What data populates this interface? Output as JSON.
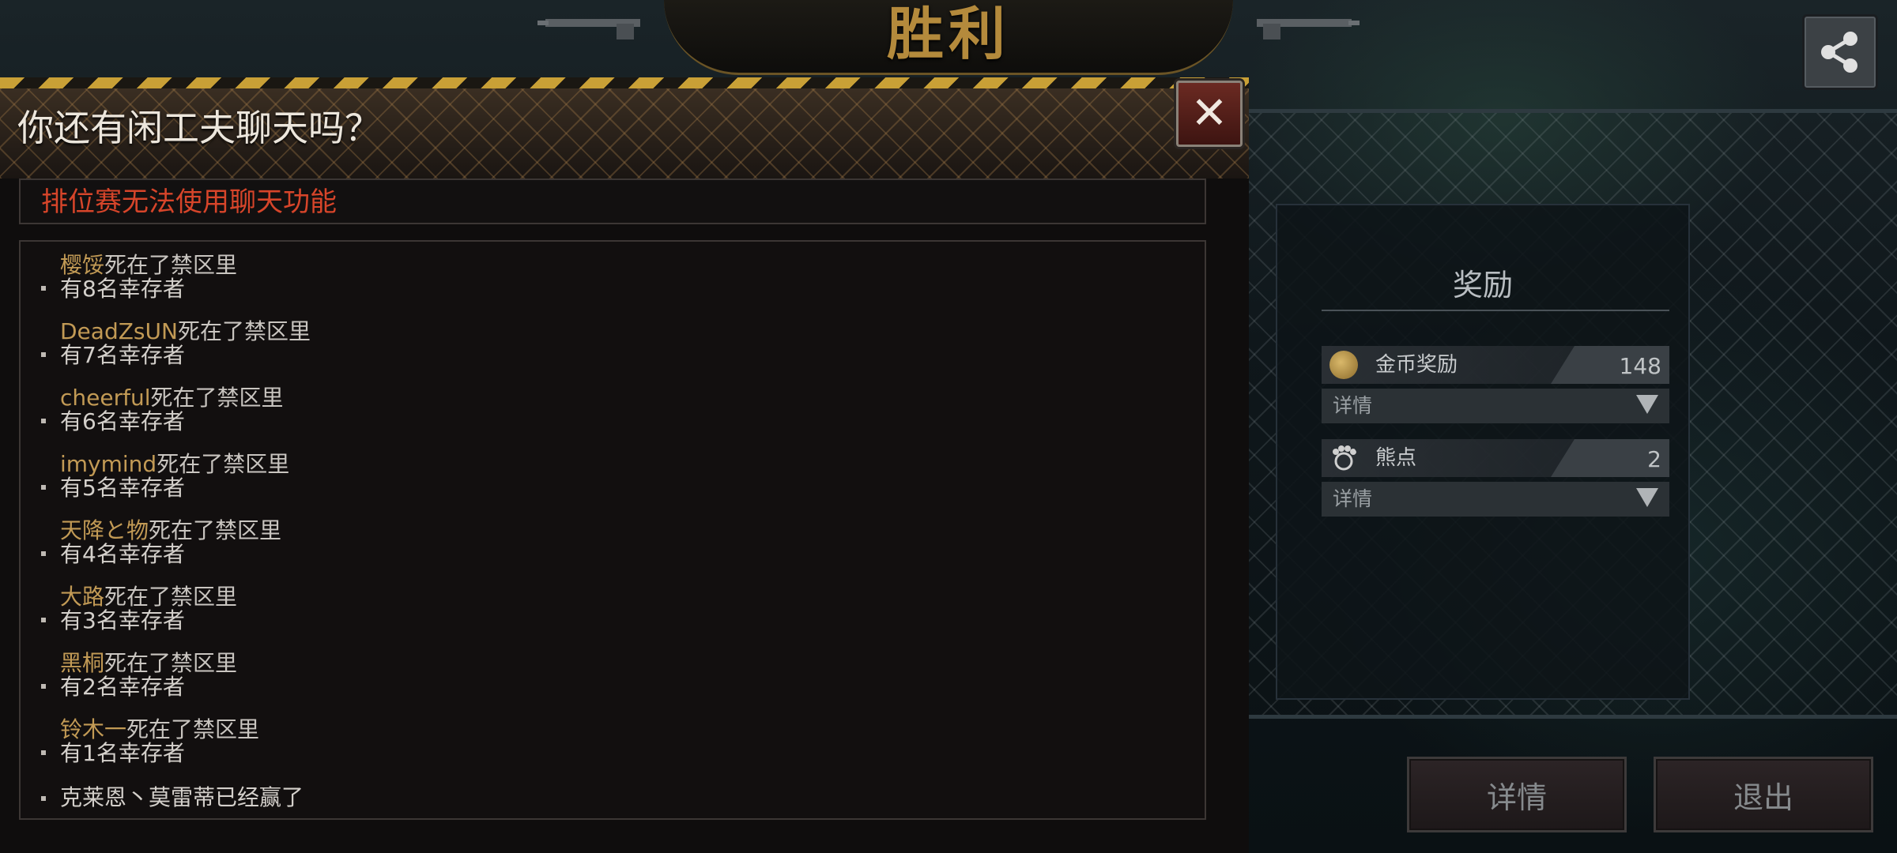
{
  "banner": {
    "title": "胜利"
  },
  "share": {
    "icon": "share-icon"
  },
  "reward_panel": {
    "title": "奖励",
    "rows": [
      {
        "icon": "gold-coin-icon",
        "label": "金币奖励",
        "value": "148",
        "detail_label": "详情"
      },
      {
        "icon": "bear-paw-icon",
        "label": "熊点",
        "value": "2",
        "detail_label": "详情"
      }
    ]
  },
  "buttons": {
    "detail": "详情",
    "exit": "退出"
  },
  "chat_dialog": {
    "title": "你还有闲工夫聊天吗？",
    "notice": "排位赛无法使用聊天功能",
    "close_icon": "close-icon",
    "log": [
      {
        "player": "樱馁",
        "action": "死在了禁区里",
        "survivors": "有8名幸存者"
      },
      {
        "player": "DeadZsUN",
        "action": "死在了禁区里",
        "survivors": "有7名幸存者"
      },
      {
        "player": "cheerful",
        "action": "死在了禁区里",
        "survivors": "有6名幸存者"
      },
      {
        "player": "imymind",
        "action": "死在了禁区里",
        "survivors": "有5名幸存者"
      },
      {
        "player": "天降と物",
        "action": "死在了禁区里",
        "survivors": "有4名幸存者"
      },
      {
        "player": "大路",
        "action": "死在了禁区里",
        "survivors": "有3名幸存者"
      },
      {
        "player": "黑桐",
        "action": "死在了禁区里",
        "survivors": "有2名幸存者"
      },
      {
        "player": "铃木一",
        "action": "死在了禁区里",
        "survivors": "有1名幸存者"
      }
    ],
    "final_message": "克莱恩丶莫雷蒂已经赢了"
  },
  "colors": {
    "accent_gold": "#c29a55",
    "notice_red": "#d7452a",
    "hazard_yellow": "#c9a036",
    "close_red": "#6b2a22"
  }
}
